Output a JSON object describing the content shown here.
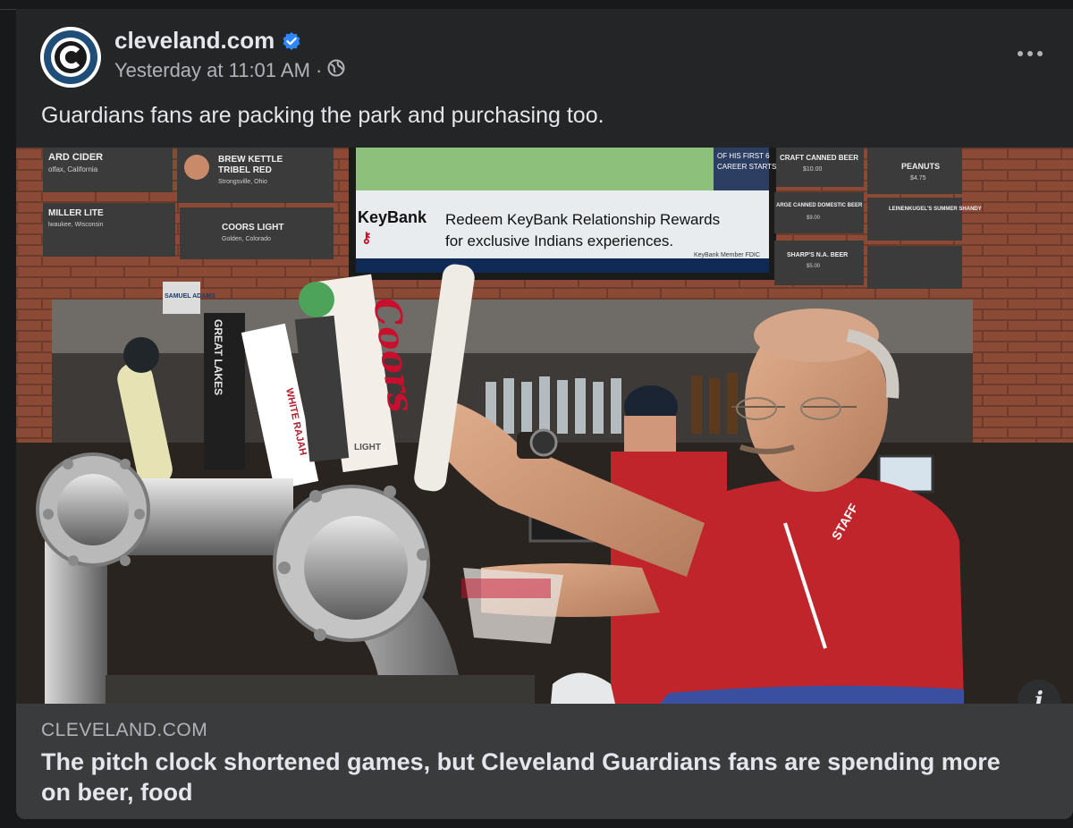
{
  "post": {
    "page_name": "cleveland.com",
    "verified_icon": "verified-badge-icon",
    "timestamp": "Yesterday at 11:01 AM",
    "separator": "·",
    "audience_icon": "globe-icon",
    "more_icon": "more-options-icon",
    "caption": "Guardians fans are packing the park and purchasing too."
  },
  "photo": {
    "signs": {
      "ard_cider": "ARD CIDER",
      "ard_cider_sub": "olfax, California",
      "brew_kettle": "BREW KETTLE",
      "tribel_red": "TRIBEL RED",
      "brew_sub": "Strongsville, Ohio",
      "miller_lite": "MILLER LITE",
      "miller_sub": "lwaukee, Wisconsin",
      "coors_light": "COORS LIGHT",
      "coors_sub": "Golden, Colorado",
      "career": "OF HIS FIRST 6",
      "career2": "CAREER STARTS",
      "craft_canned": "CRAFT CANNED BEER",
      "craft_price": "$10.00",
      "peanuts": "PEANUTS",
      "peanuts_price": "$4.75",
      "large_canned": "ARGE CANNED DOMESTIC BEER",
      "large_price": "$9.00",
      "leinenkugels": "LEINENKUGEL'S SUMMER SHANDY",
      "sharps": "SHARP'S N.A. BEER",
      "sharps_price": "$5.00"
    },
    "tv": {
      "brand": "KeyBank",
      "line1": "Redeem KeyBank Relationship Rewards",
      "line2": "for exclusive Indians experiences.",
      "member": "KeyBank Member FDIC"
    },
    "taps": {
      "coors": "Coors",
      "coors_light": "LIGHT",
      "great_lakes": "GREAT LAKES",
      "white_rajah": "WHITE RAJAH",
      "samuel_adams": "SAMUEL ADAMS",
      "staff": "STAFF"
    },
    "colors": {
      "brick": "#8a4a35",
      "shirt_red": "#c0252b",
      "tv_blue": "#0e2a55"
    }
  },
  "info_icon": "info-icon",
  "info_label": "i",
  "link": {
    "domain": "CLEVELAND.COM",
    "title": "The pitch clock shortened games, but Cleveland Guardians fans are spending more on beer, food"
  }
}
